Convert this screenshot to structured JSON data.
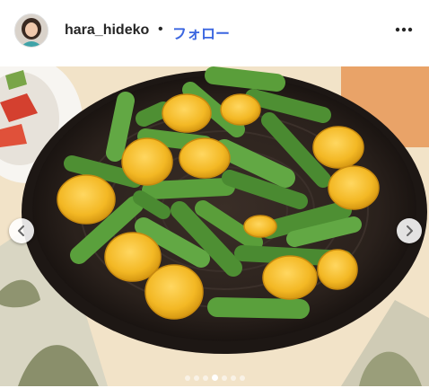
{
  "post": {
    "username": "hara_hideko",
    "separator": "•",
    "follow_label": "フォロー",
    "more_icon": "more-horizontal-icon"
  },
  "carousel": {
    "slide_count": 7,
    "active_index": 3,
    "prev_icon": "chevron-left-icon",
    "next_icon": "chevron-right-icon"
  },
  "colors": {
    "follow_blue": "#3b66e0",
    "username": "#262626",
    "plate": "#2a211c",
    "asparagus": "#5a9e3a",
    "squash": "#f0b922"
  }
}
